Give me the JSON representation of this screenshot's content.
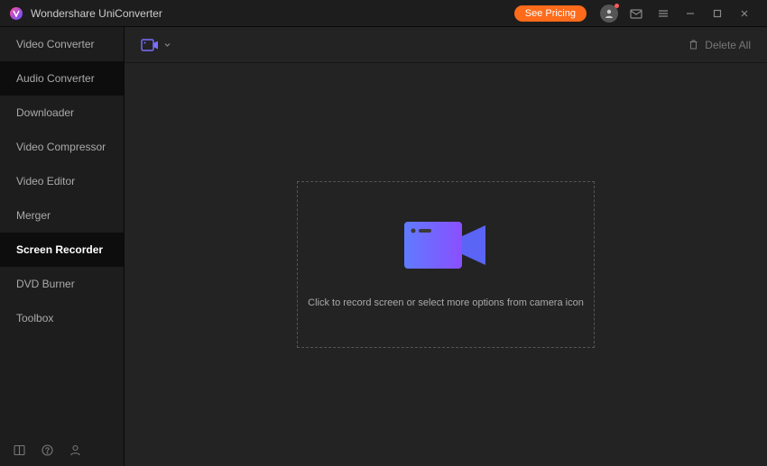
{
  "app": {
    "title": "Wondershare UniConverter"
  },
  "header": {
    "pricing_label": "See Pricing"
  },
  "sidebar": {
    "items": [
      {
        "label": "Video Converter"
      },
      {
        "label": "Audio Converter"
      },
      {
        "label": "Downloader"
      },
      {
        "label": "Video Compressor"
      },
      {
        "label": "Video Editor"
      },
      {
        "label": "Merger"
      },
      {
        "label": "Screen Recorder"
      },
      {
        "label": "DVD Burner"
      },
      {
        "label": "Toolbox"
      }
    ],
    "active_index": 6
  },
  "toolbar": {
    "delete_all_label": "Delete All"
  },
  "workspace": {
    "instruction": "Click to record screen or select more options from camera icon"
  },
  "colors": {
    "accent_orange": "#ff6b1a",
    "accent_purple": "#7a6fff",
    "gradient_start": "#5f7bff",
    "gradient_end": "#8a4fff"
  }
}
